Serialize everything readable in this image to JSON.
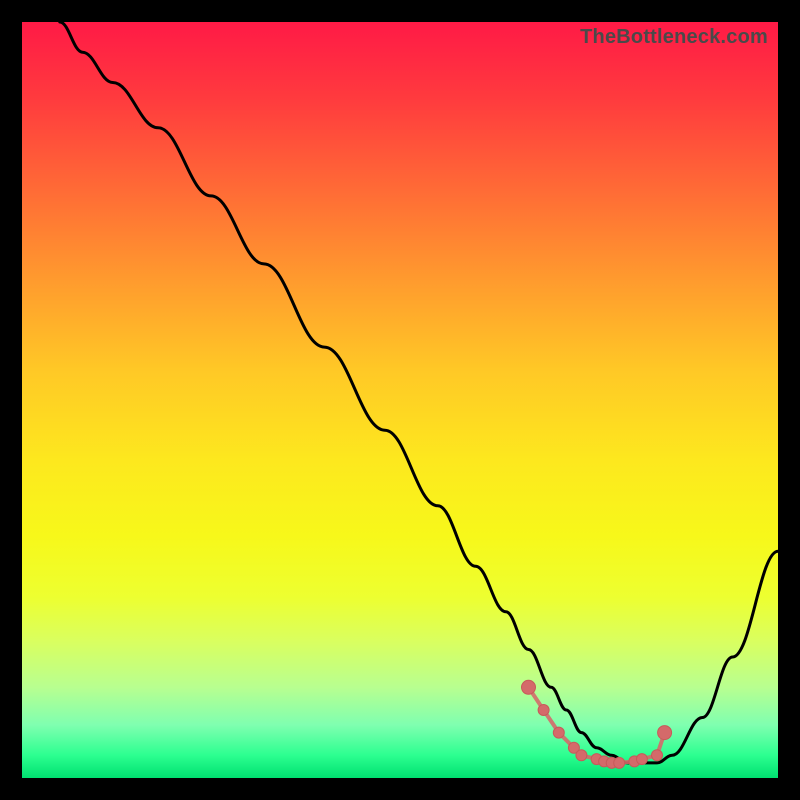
{
  "watermark": "TheBottleneck.com",
  "colors": {
    "curve_stroke": "#000000",
    "marker_fill": "#d46a6a",
    "marker_stroke": "#c85a5a"
  },
  "chart_data": {
    "type": "line",
    "title": "",
    "xlabel": "",
    "ylabel": "",
    "xlim": [
      0,
      100
    ],
    "ylim": [
      0,
      100
    ],
    "grid": false,
    "legend": false,
    "series": [
      {
        "name": "curve",
        "x": [
          5,
          8,
          12,
          18,
          25,
          32,
          40,
          48,
          55,
          60,
          64,
          67,
          70,
          72,
          74,
          76,
          78,
          80,
          82,
          84,
          86,
          90,
          94,
          100
        ],
        "y": [
          100,
          96,
          92,
          86,
          77,
          68,
          57,
          46,
          36,
          28,
          22,
          17,
          12,
          9,
          6,
          4,
          3,
          2,
          2,
          2,
          3,
          8,
          16,
          30
        ]
      }
    ],
    "markers": {
      "name": "highlighted-points",
      "x": [
        67,
        69,
        71,
        73,
        74,
        76,
        77,
        78,
        79,
        81,
        82,
        84,
        85
      ],
      "y": [
        12,
        9,
        6,
        4,
        3,
        2.5,
        2.2,
        2,
        2,
        2.2,
        2.5,
        3,
        6
      ]
    }
  }
}
